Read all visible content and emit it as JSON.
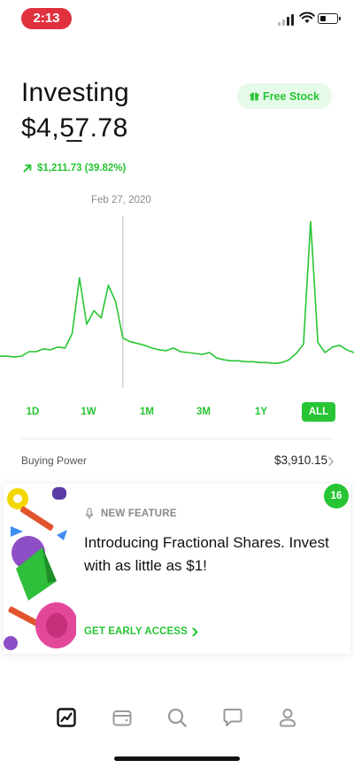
{
  "status_bar": {
    "time": "2:13"
  },
  "header": {
    "title": "Investing",
    "balance": "$4,5̲7.78",
    "free_stock_label": "Free Stock",
    "gain": "$1,211.73 (39.82%)",
    "gain_icon": "arrow-up-right-icon"
  },
  "chart": {
    "date_label": "Feb 27, 2020",
    "line_color": "#27c533"
  },
  "chart_data": {
    "type": "line",
    "title": "",
    "xlabel": "",
    "ylabel": "",
    "x": [
      0,
      1,
      2,
      3,
      4,
      5,
      6,
      7,
      8,
      9,
      10,
      11,
      12,
      13,
      14,
      15,
      16,
      17,
      18,
      19,
      20,
      21,
      22,
      23,
      24,
      25,
      26,
      27,
      28,
      29,
      30,
      31,
      32,
      33,
      34,
      35,
      36,
      37,
      38,
      39,
      40,
      41,
      42,
      43,
      44,
      45,
      46,
      47,
      48,
      49
    ],
    "series": [
      {
        "values": [
          32,
          32,
          31,
          32,
          37,
          37,
          40,
          39,
          42,
          41,
          57,
          118,
          67,
          82,
          74,
          110,
          92,
          52,
          48,
          46,
          44,
          41,
          39,
          38,
          41,
          37,
          36,
          35,
          34,
          36,
          30,
          28,
          27,
          27,
          26,
          26,
          25,
          25,
          24,
          25,
          28,
          35,
          45,
          180,
          47,
          36,
          42,
          44,
          39,
          36
        ]
      }
    ],
    "cursor_index": 17,
    "grid": false
  },
  "ranges": {
    "items": [
      "1D",
      "1W",
      "1M",
      "3M",
      "1Y",
      "ALL"
    ],
    "active": "ALL"
  },
  "buying_power": {
    "label": "Buying Power",
    "value": "$3,910.15"
  },
  "feature_card": {
    "badge": "16",
    "tag": "NEW FEATURE",
    "text": "Introducing Fractional Shares. Invest with as little as $1!",
    "cta": "GET EARLY ACCESS"
  },
  "nav": {
    "items": [
      "chart-icon",
      "wallet-icon",
      "search-icon",
      "chat-icon",
      "profile-icon"
    ],
    "active": "chart-icon"
  },
  "colors": {
    "accent": "#27c533",
    "time_pill": "#e0313f"
  }
}
